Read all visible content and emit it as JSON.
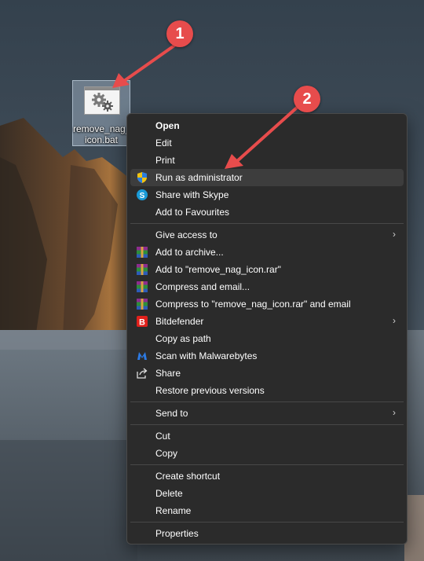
{
  "desktop": {
    "file_icon": {
      "label_line1": "remove_nag_",
      "label_line2": "icon.bat",
      "icon": "gear-batch-file-icon"
    }
  },
  "annotations": [
    {
      "number": "1",
      "color": "#e74c4c"
    },
    {
      "number": "2",
      "color": "#e74c4c"
    }
  ],
  "context_menu": {
    "groups": [
      [
        {
          "label": "Open",
          "bold": true
        },
        {
          "label": "Edit"
        },
        {
          "label": "Print"
        },
        {
          "label": "Run as administrator",
          "icon": "uac-shield-icon",
          "highlighted": true
        },
        {
          "label": "Share with Skype",
          "icon": "skype-icon"
        },
        {
          "label": "Add to Favourites"
        }
      ],
      [
        {
          "label": "Give access to",
          "submenu": true
        },
        {
          "label": "Add to archive...",
          "icon": "winrar-icon"
        },
        {
          "label": "Add to \"remove_nag_icon.rar\"",
          "icon": "winrar-icon"
        },
        {
          "label": "Compress and email...",
          "icon": "winrar-icon"
        },
        {
          "label": "Compress to \"remove_nag_icon.rar\" and email",
          "icon": "winrar-icon"
        },
        {
          "label": "Bitdefender",
          "icon": "bitdefender-icon",
          "submenu": true
        },
        {
          "label": "Copy as path"
        },
        {
          "label": "Scan with Malwarebytes",
          "icon": "malwarebytes-icon"
        },
        {
          "label": "Share",
          "icon": "share-icon"
        },
        {
          "label": "Restore previous versions"
        }
      ],
      [
        {
          "label": "Send to",
          "submenu": true
        }
      ],
      [
        {
          "label": "Cut"
        },
        {
          "label": "Copy"
        }
      ],
      [
        {
          "label": "Create shortcut"
        },
        {
          "label": "Delete"
        },
        {
          "label": "Rename"
        }
      ],
      [
        {
          "label": "Properties"
        }
      ]
    ]
  },
  "colors": {
    "menu_bg": "#2b2b2b",
    "menu_highlight": "#3d3d3d",
    "annotation_red": "#e74c4c",
    "text": "#ffffff"
  }
}
